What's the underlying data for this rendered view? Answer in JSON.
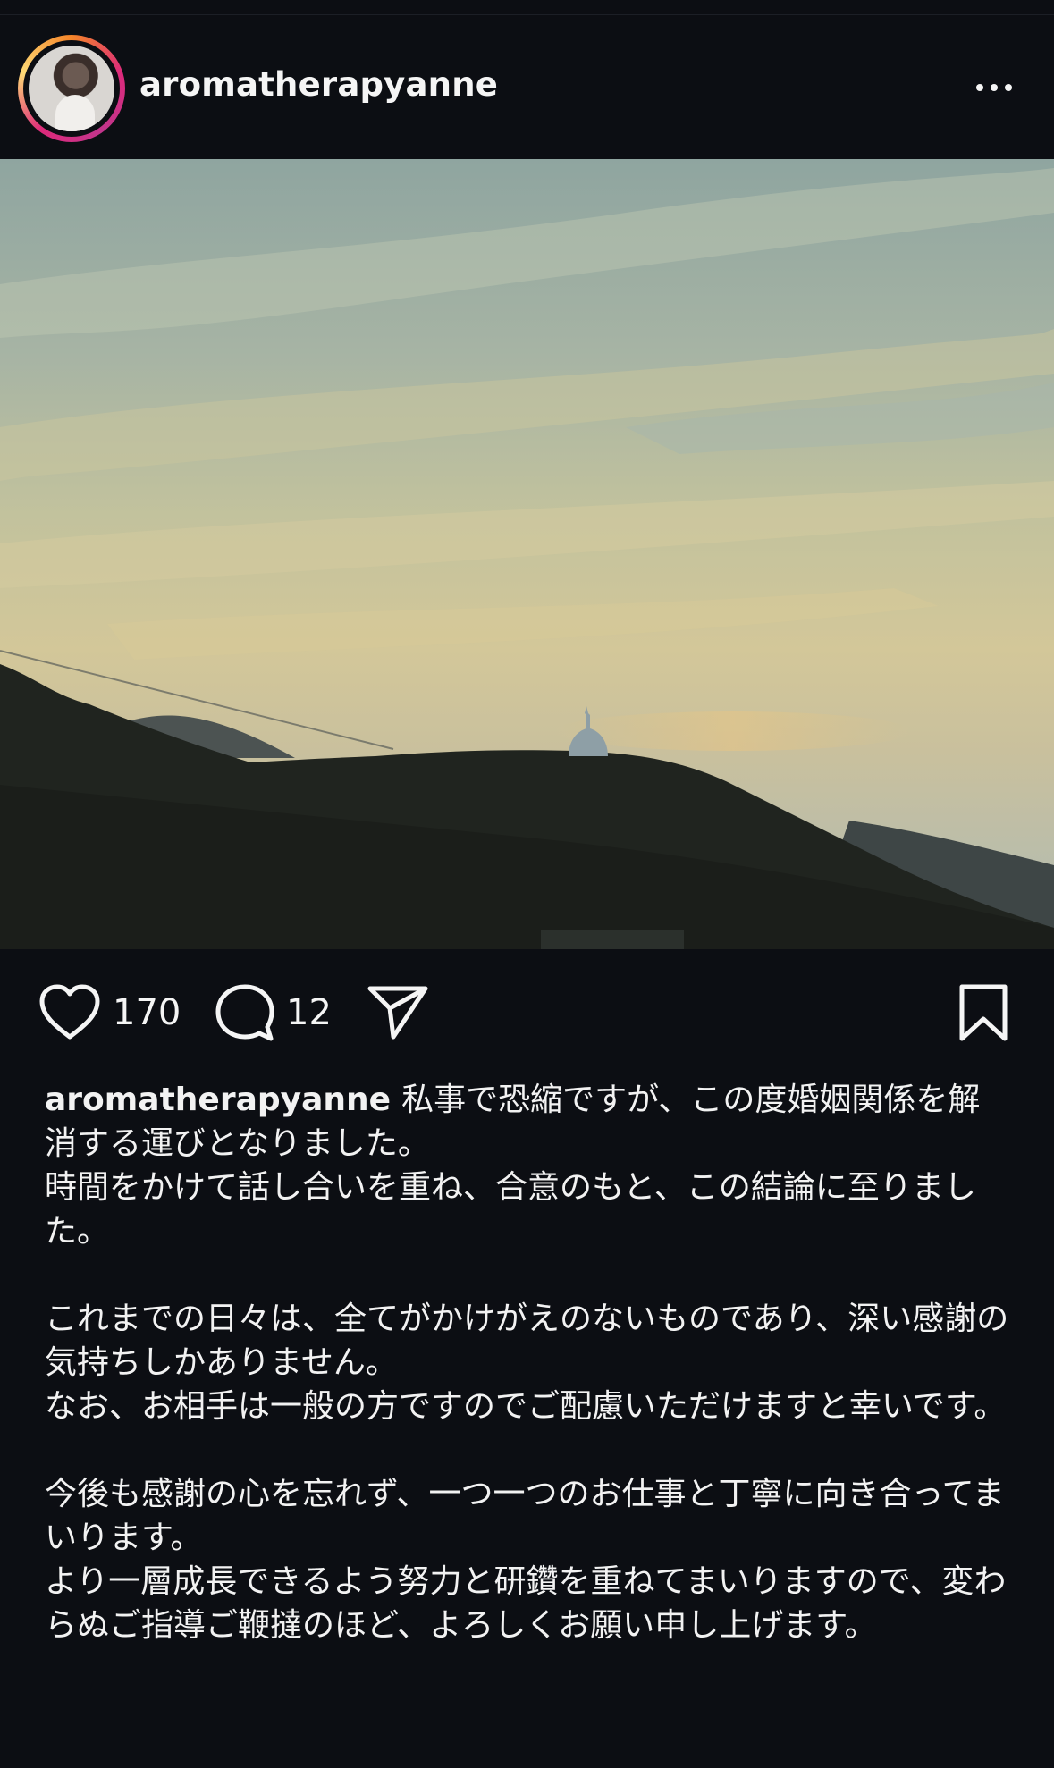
{
  "post": {
    "username": "aromatherapyanne",
    "likes": "170",
    "comments": "12"
  },
  "icons": {
    "more": "more-horizontal-icon",
    "like": "heart-icon",
    "comment": "comment-bubble-icon",
    "share": "paper-plane-icon",
    "save": "bookmark-icon"
  },
  "caption": {
    "username": "aromatherapyanne",
    "lines": [
      "私事で恐縮ですが、この度婚姻関係を解消する運びとなりました。",
      "時間をかけて話し合いを重ね、合意のもと、この結論に至りました。",
      "これまでの日々は、全てがかけがえのないものであり、深い感謝の気持ちしかありません。",
      "なお、お相手は一般の方ですのでご配慮いただけますと幸いです。",
      "今後も感謝の心を忘れず、一つ一つのお仕事と丁寧に向き合ってまいります。",
      "より一層成長できるよう努力と研鑽を重ねてまいりますので、変わらぬご指導ご鞭撻のほど、よろしくお願い申し上げます。"
    ]
  }
}
